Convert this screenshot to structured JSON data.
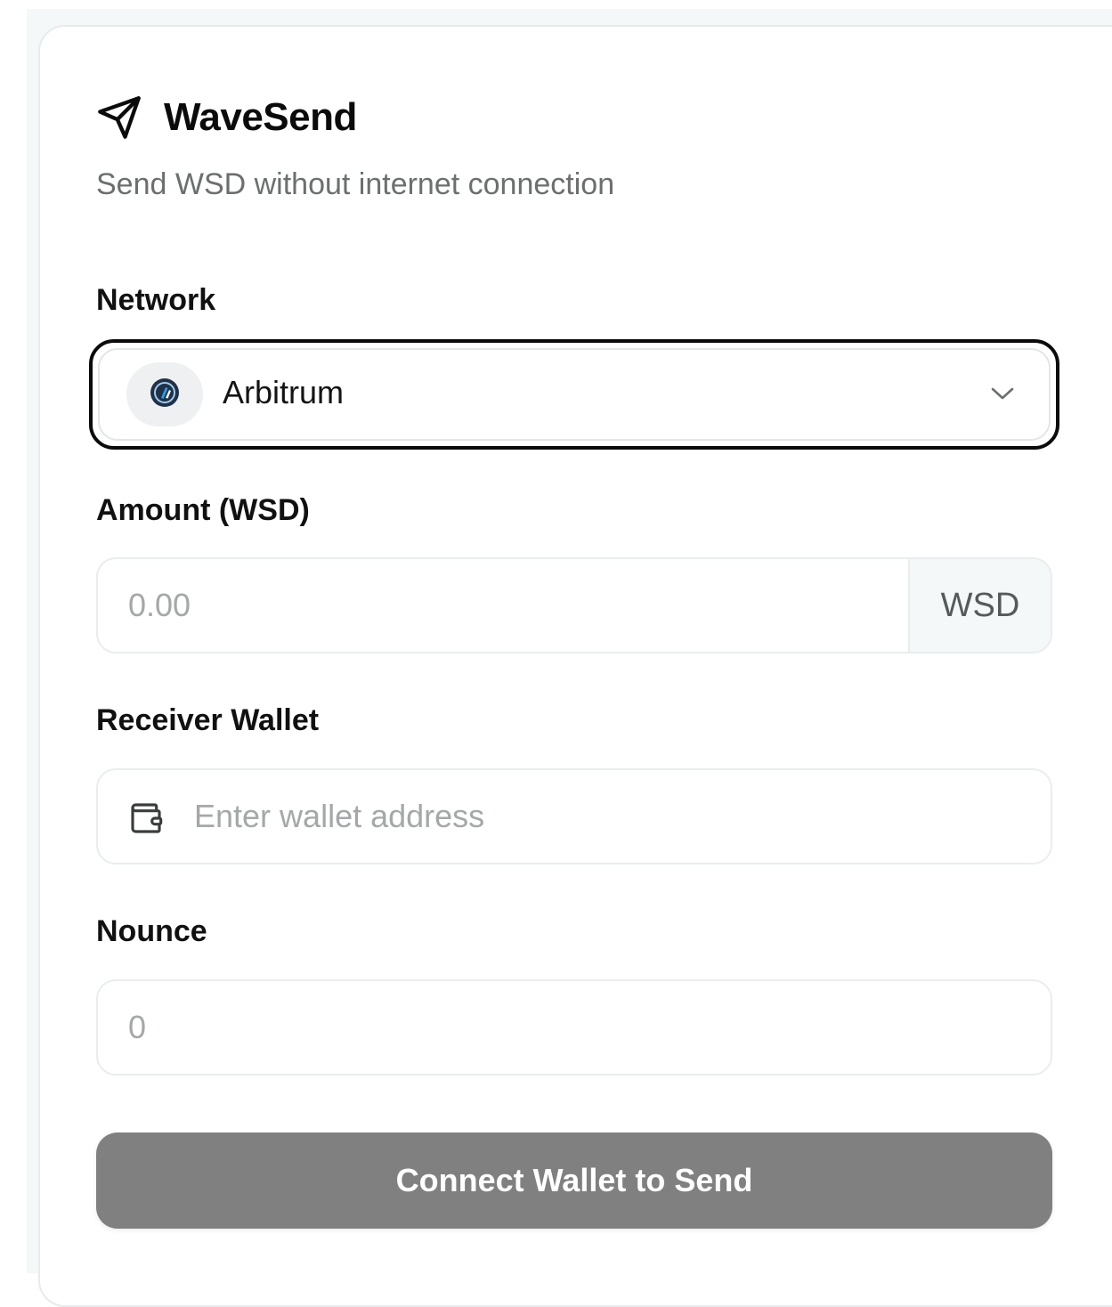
{
  "app": {
    "title": "WaveSend",
    "subtitle": "Send WSD without internet connection"
  },
  "network": {
    "label": "Network",
    "selected": "Arbitrum",
    "icon": "arbitrum-logo-icon"
  },
  "amount": {
    "label": "Amount (WSD)",
    "placeholder": "0.00",
    "value": "",
    "unit": "WSD"
  },
  "receiver": {
    "label": "Receiver Wallet",
    "placeholder": "Enter wallet address",
    "value": "",
    "icon": "wallet-icon"
  },
  "nonce": {
    "label": "Nounce",
    "placeholder": "0",
    "value": ""
  },
  "action": {
    "button_label": "Connect Wallet to Send",
    "button_color": "#808080"
  },
  "colors": {
    "accent_dark": "#0b0b0b",
    "muted_text": "#6b6f6f",
    "placeholder": "#a4a8a8",
    "addon_bg": "#f4f8f8",
    "arbitrum_navy": "#213147",
    "arbitrum_blue": "#28a0f0"
  }
}
